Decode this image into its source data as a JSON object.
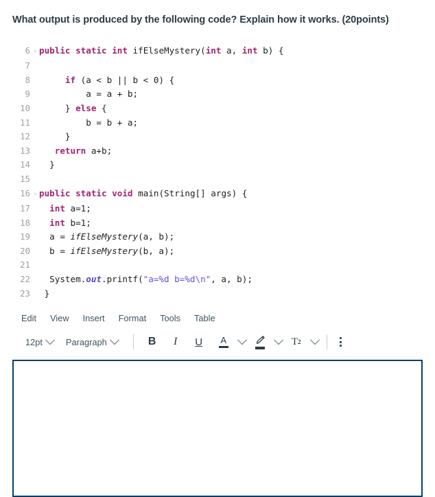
{
  "question": {
    "prompt": "What output is produced by the following code? Explain how it works. (20points)"
  },
  "code_block": {
    "language": "java",
    "lines": [
      {
        "number": "6",
        "fold": "◦",
        "indent": 0
      },
      {
        "number": "7",
        "fold": "",
        "indent": 0
      },
      {
        "number": "8",
        "fold": "",
        "indent": 0
      },
      {
        "number": "9",
        "fold": "",
        "indent": 0
      },
      {
        "number": "10",
        "fold": "",
        "indent": 0
      },
      {
        "number": "11",
        "fold": "",
        "indent": 0
      },
      {
        "number": "12",
        "fold": "",
        "indent": 0
      },
      {
        "number": "13",
        "fold": "",
        "indent": 0
      },
      {
        "number": "14",
        "fold": "",
        "indent": 0
      },
      {
        "number": "15",
        "fold": "",
        "indent": 0
      },
      {
        "number": "16",
        "fold": "◦",
        "indent": 0
      },
      {
        "number": "17",
        "fold": "",
        "indent": 0
      },
      {
        "number": "18",
        "fold": "",
        "indent": 0
      },
      {
        "number": "19",
        "fold": "",
        "indent": 0
      },
      {
        "number": "20",
        "fold": "",
        "indent": 0
      },
      {
        "number": "21",
        "fold": "",
        "indent": 0
      },
      {
        "number": "22",
        "fold": "",
        "indent": 0
      },
      {
        "number": "23",
        "fold": "",
        "indent": 0
      }
    ],
    "source_lines": [
      "public static int ifElseMystery(int a, int b) {",
      "",
      "    if (a < b || b < 0) {",
      "        a = a + b;",
      "    } else {",
      "        b = b + a;",
      "    }",
      "  return a+b;",
      " }",
      "",
      "public static void main(String[] args) {",
      "  int a=1;",
      "  int b=1;",
      "  a = ifElseMystery(a, b);",
      "  b = ifElseMystery(b, a);",
      "",
      "  System.out.printf(\"a=%d b=%d\\n\", a, b);",
      " }"
    ],
    "colors": {
      "keyword": "#a2246f",
      "string": "#6a4fd8",
      "field": "#5a46c8",
      "line_number": "#9aa0a6",
      "fold_marker": "#3aa6a6",
      "text": "#1d1d1d"
    }
  },
  "rce": {
    "menubar": [
      {
        "label": "Edit"
      },
      {
        "label": "View"
      },
      {
        "label": "Insert"
      },
      {
        "label": "Format"
      },
      {
        "label": "Tools"
      },
      {
        "label": "Table"
      }
    ],
    "toolbar": {
      "font_size": "12pt",
      "block_format": "Paragraph",
      "bold_label": "B",
      "italic_label": "I",
      "underline_label": "U",
      "text_color_label": "A",
      "superscript_label": "T",
      "superscript_exponent": "2",
      "more_label": "⋮"
    },
    "editor": {
      "content": "",
      "border_color": "#0a3d69"
    }
  }
}
